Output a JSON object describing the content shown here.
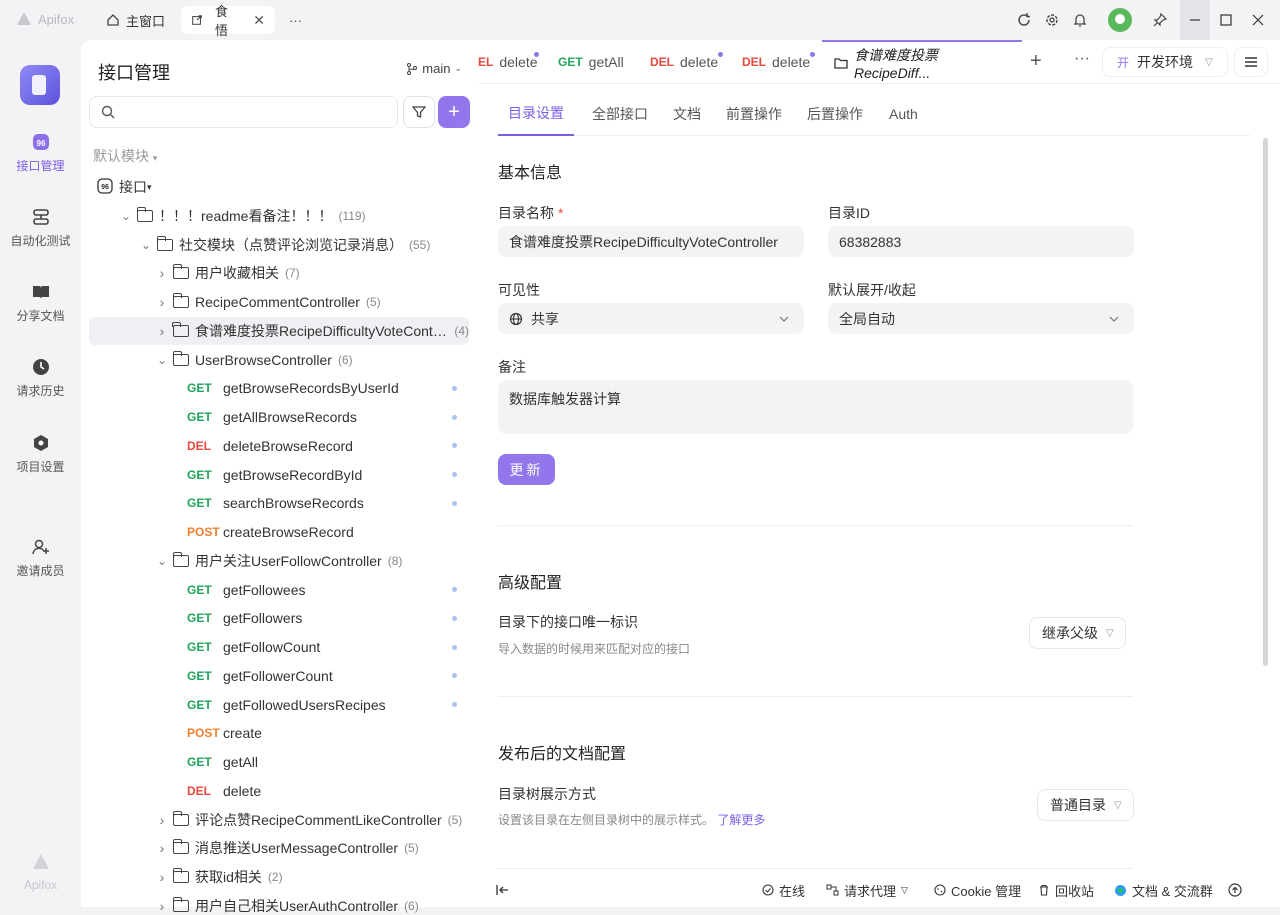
{
  "app": {
    "name": "Apifox"
  },
  "titlebar": {
    "tabs": [
      {
        "label": "主窗口",
        "active": false
      },
      {
        "label": "食悟",
        "active": true
      }
    ],
    "more": "···"
  },
  "rail": {
    "items": [
      {
        "label": "接口管理",
        "active": true
      },
      {
        "label": "自动化测试"
      },
      {
        "label": "分享文档"
      },
      {
        "label": "请求历史"
      },
      {
        "label": "项目设置"
      },
      {
        "label": "邀请成员"
      }
    ],
    "bottom_logo": "Apifox"
  },
  "sidebar": {
    "title": "接口管理",
    "branch": "main",
    "search_placeholder": "",
    "module": "默认模块",
    "tree": [
      {
        "level": 0,
        "type": "root",
        "label": "接口"
      },
      {
        "level": 1,
        "type": "folder",
        "open": true,
        "label": "！！！readme看备注！！！",
        "count": "(119)"
      },
      {
        "level": 2,
        "type": "folder",
        "open": true,
        "label": "社交模块（点赞评论浏览记录消息）",
        "count": "(55)"
      },
      {
        "level": 3,
        "type": "folder",
        "open": false,
        "label": "用户收藏相关",
        "count": "(7)"
      },
      {
        "level": 3,
        "type": "folder",
        "open": false,
        "label": "RecipeCommentController",
        "count": "(5)"
      },
      {
        "level": 3,
        "type": "folder",
        "open": false,
        "label": "食谱难度投票RecipeDifficultyVoteContr...",
        "count": "(4)",
        "selected": true
      },
      {
        "level": 3,
        "type": "folder",
        "open": true,
        "label": "UserBrowseController",
        "count": "(6)"
      },
      {
        "level": 4,
        "type": "api",
        "method": "GET",
        "label": "getBrowseRecordsByUserId",
        "dot": true
      },
      {
        "level": 4,
        "type": "api",
        "method": "GET",
        "label": "getAllBrowseRecords",
        "dot": true
      },
      {
        "level": 4,
        "type": "api",
        "method": "DEL",
        "label": "deleteBrowseRecord",
        "dot": true
      },
      {
        "level": 4,
        "type": "api",
        "method": "GET",
        "label": "getBrowseRecordById",
        "dot": true
      },
      {
        "level": 4,
        "type": "api",
        "method": "GET",
        "label": "searchBrowseRecords",
        "dot": true
      },
      {
        "level": 4,
        "type": "api",
        "method": "POST",
        "label": "createBrowseRecord",
        "dot": false
      },
      {
        "level": 3,
        "type": "folder",
        "open": true,
        "label": "用户关注UserFollowController",
        "count": "(8)"
      },
      {
        "level": 4,
        "type": "api",
        "method": "GET",
        "label": "getFollowees",
        "dot": true
      },
      {
        "level": 4,
        "type": "api",
        "method": "GET",
        "label": "getFollowers",
        "dot": true
      },
      {
        "level": 4,
        "type": "api",
        "method": "GET",
        "label": "getFollowCount",
        "dot": true
      },
      {
        "level": 4,
        "type": "api",
        "method": "GET",
        "label": "getFollowerCount",
        "dot": true
      },
      {
        "level": 4,
        "type": "api",
        "method": "GET",
        "label": "getFollowedUsersRecipes",
        "dot": true
      },
      {
        "level": 4,
        "type": "api",
        "method": "POST",
        "label": "create",
        "dot": false
      },
      {
        "level": 4,
        "type": "api",
        "method": "GET",
        "label": "getAll",
        "dot": false
      },
      {
        "level": 4,
        "type": "api",
        "method": "DEL",
        "label": "delete",
        "dot": false
      },
      {
        "level": 3,
        "type": "folder",
        "open": false,
        "label": "评论点赞RecipeCommentLikeController",
        "count": "(5)"
      },
      {
        "level": 3,
        "type": "folder",
        "open": false,
        "label": "消息推送UserMessageController",
        "count": "(5)"
      },
      {
        "level": 3,
        "type": "folder",
        "open": false,
        "label": "获取id相关",
        "count": "(2)"
      },
      {
        "level": 3,
        "type": "folder",
        "open": false,
        "label": "用户自己相关UserAuthController",
        "count": "(6)"
      }
    ]
  },
  "main": {
    "tabs": [
      {
        "method": "EL",
        "label": "delete",
        "dot": true
      },
      {
        "method": "GET",
        "label": "getAll",
        "dot": false
      },
      {
        "method": "DEL",
        "label": "delete",
        "dot": true
      },
      {
        "method": "DEL",
        "label": "delete",
        "dot": true
      },
      {
        "method": "",
        "label": "食谱难度投票RecipeDiff...",
        "active": true
      }
    ],
    "env": {
      "badge": "开",
      "label": "开发环境"
    },
    "subtabs": [
      {
        "label": "目录设置",
        "active": true
      },
      {
        "label": "全部接口"
      },
      {
        "label": "文档"
      },
      {
        "label": "前置操作"
      },
      {
        "label": "后置操作"
      },
      {
        "label": "Auth"
      }
    ],
    "basic": {
      "title": "基本信息",
      "name_label": "目录名称",
      "name_value": "食谱难度投票RecipeDifficultyVoteController",
      "id_label": "目录ID",
      "id_value": "68382883",
      "visibility_label": "可见性",
      "visibility_value": "共享",
      "expand_label": "默认展开/收起",
      "expand_value": "全局自动",
      "note_label": "备注",
      "note_value": "数据库触发器计算",
      "update_button": "更新"
    },
    "advanced": {
      "title": "高级配置",
      "unique_label": "目录下的接口唯一标识",
      "unique_desc": "导入数据的时候用来匹配对应的接口",
      "unique_value": "继承父级"
    },
    "publish": {
      "title": "发布后的文档配置",
      "tree_label": "目录树展示方式",
      "tree_desc": "设置该目录在左侧目录树中的展示样式。",
      "learn_more": "了解更多",
      "tree_value": "普通目录"
    },
    "footer": {
      "online": "在线",
      "proxy": "请求代理",
      "cookie": "Cookie 管理",
      "recycle": "回收站",
      "docs": "文档 & 交流群"
    }
  },
  "colors": {
    "accent": "#9176ec",
    "get": "#20a55a",
    "del": "#e5483e",
    "post": "#f07f30"
  }
}
